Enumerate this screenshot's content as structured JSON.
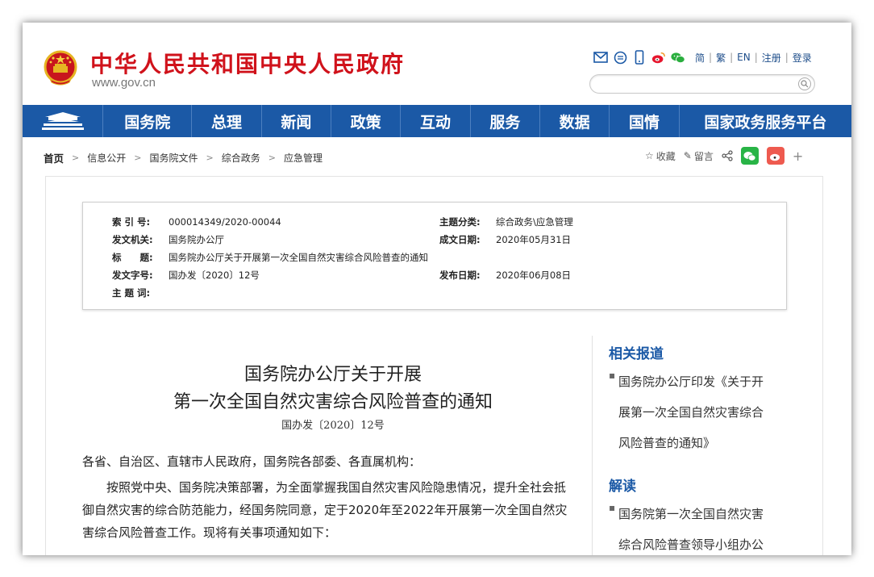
{
  "header": {
    "site_title": "中华人民共和国中央人民政府",
    "site_url": "www.gov.cn",
    "icons": [
      "mail-icon",
      "message-icon",
      "mobile-icon",
      "weibo-icon",
      "wechat-icon"
    ],
    "lang_links": [
      "简",
      "繁",
      "EN",
      "注册",
      "登录"
    ],
    "search_placeholder": ""
  },
  "nav": {
    "items": [
      "国务院",
      "总理",
      "新闻",
      "政策",
      "互动",
      "服务",
      "数据",
      "国情",
      "国家政务服务平台"
    ]
  },
  "breadcrumb": {
    "home": "首页",
    "items": [
      "信息公开",
      "国务院文件",
      "综合政务",
      "应急管理"
    ]
  },
  "actions": {
    "favorite": "收藏",
    "comment": "留言"
  },
  "meta": {
    "index_no_label": "索 引 号:",
    "index_no": "000014349/2020-00044",
    "issuer_label": "发文机关:",
    "issuer": "国务院办公厅",
    "title_label": "标　　题:",
    "title": "国务院办公厅关于开展第一次全国自然灾害综合风险普查的通知",
    "doc_no_label": "发文字号:",
    "doc_no": "国办发〔2020〕12号",
    "keywords_label": "主 题 词:",
    "keywords": "",
    "category_label": "主题分类:",
    "category": "综合政务\\应急管理",
    "created_label": "成文日期:",
    "created": "2020年05月31日",
    "published_label": "发布日期:",
    "published": "2020年06月08日"
  },
  "article": {
    "title_line1": "国务院办公厅关于开展",
    "title_line2": "第一次全国自然灾害综合风险普查的通知",
    "doc_no": "国办发〔2020〕12号",
    "para1": "各省、自治区、直辖市人民政府，国务院各部委、各直属机构：",
    "para2": "按照党中央、国务院决策部署，为全面掌握我国自然灾害风险隐患情况，提升全社会抵御自然灾害的综合防范能力，经国务院同意，定于2020年至2022年开展第一次全国自然灾害综合风险普查工作。现将有关事项通知如下："
  },
  "sidebar": {
    "related_heading": "相关报道",
    "related_item": "国务院办公厅印发《关于开展第一次全国自然灾害综合风险普查的通知》",
    "interpret_heading": "解读",
    "interpret_item": "国务院第一次全国自然灾害综合风险普查领导小组办公室负"
  },
  "colors": {
    "brand_red": "#d0121b",
    "nav_blue": "#1b59a6",
    "wechat_green": "#28b446",
    "weibo_red": "#ee5a4f"
  }
}
